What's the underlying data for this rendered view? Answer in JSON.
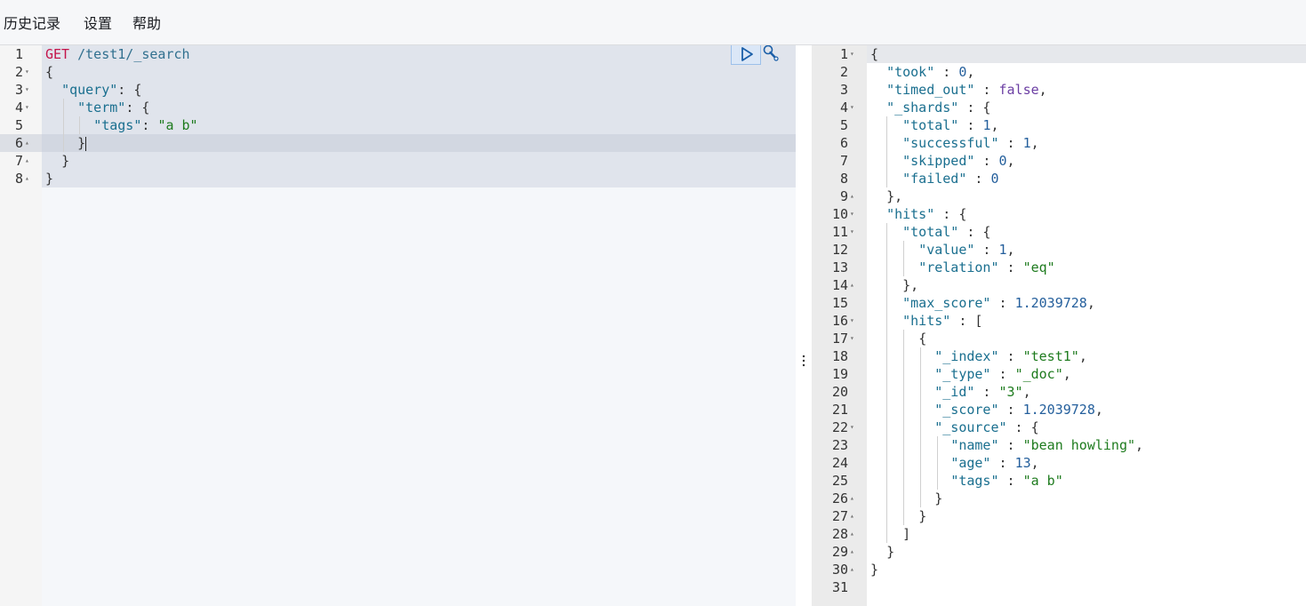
{
  "menu": {
    "history": "历史记录",
    "settings": "设置",
    "help": "帮助"
  },
  "request": {
    "method": "GET",
    "url": "/test1/_search",
    "line_numbers": [
      "1",
      "2",
      "3",
      "4",
      "5",
      "6",
      "7",
      "8"
    ],
    "body_lines": [
      "{",
      "  \"query\": {",
      "    \"term\": {",
      "      \"tags\": \"a b\"",
      "    }",
      "  }",
      "}"
    ],
    "active_line": "6"
  },
  "response": {
    "line_numbers": [
      "1",
      "2",
      "3",
      "4",
      "5",
      "6",
      "7",
      "8",
      "9",
      "10",
      "11",
      "12",
      "13",
      "14",
      "15",
      "16",
      "17",
      "18",
      "19",
      "20",
      "21",
      "22",
      "23",
      "24",
      "25",
      "26",
      "27",
      "28",
      "29",
      "30",
      "31"
    ],
    "took": "0",
    "timed_out": "false",
    "shards_total": "1",
    "shards_successful": "1",
    "shards_skipped": "0",
    "shards_failed": "0",
    "hits_total_value": "1",
    "hits_total_relation": "\"eq\"",
    "max_score": "1.2039728",
    "hit_index": "\"test1\"",
    "hit_type": "\"_doc\"",
    "hit_id": "\"3\"",
    "hit_score": "1.2039728",
    "source_name": "\"bean howling\"",
    "source_age": "13",
    "source_tags": "\"a b\""
  },
  "icons": {
    "run": "play-icon",
    "wrench": "wrench-icon",
    "splitter": "vertical-dots-icon"
  },
  "colors": {
    "string": "#1e7b1e",
    "key": "#1a6f8f",
    "number": "#245f9c",
    "method": "#c4144a",
    "boolean": "#6b3ea3"
  }
}
